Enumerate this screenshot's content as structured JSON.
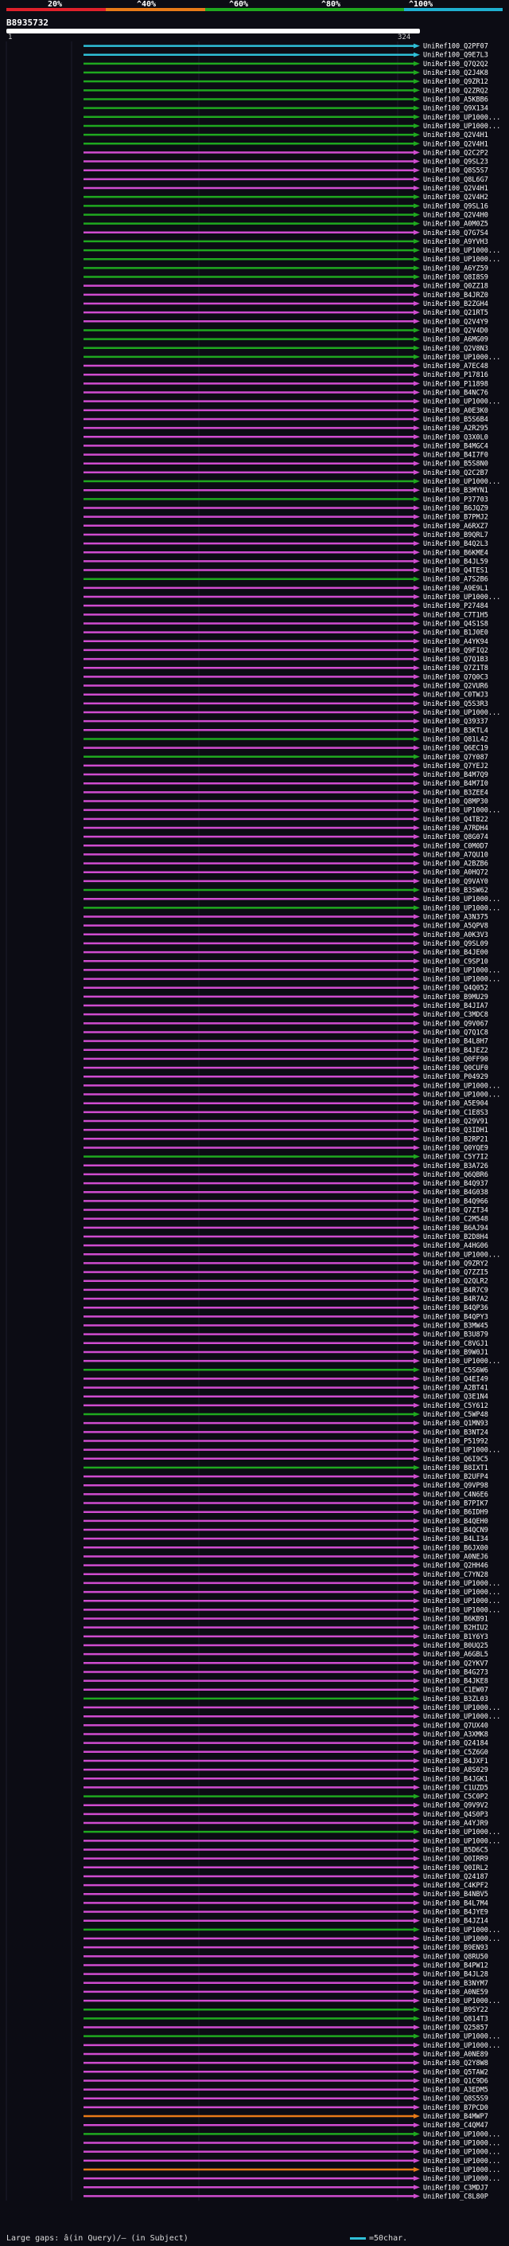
{
  "legend": {
    "labels": [
      "20%",
      "^40%",
      "^60%",
      "^80%",
      "^100%"
    ],
    "colors": [
      "#e0202a",
      "#e87a18",
      "#1fa81f",
      "#1fa81f",
      "#1fb0d0"
    ]
  },
  "query": {
    "id": "B8935732",
    "start": "1",
    "end": "324"
  },
  "footer": {
    "large_gaps": "Large gaps: â(in Query)/– (in Subject)",
    "scale": "=50char."
  },
  "hits": [
    {
      "label": "UniRef100_Q2PF07",
      "color": "#2fc0d8"
    },
    {
      "label": "UniRef100_Q9E7L3",
      "color": "#2fc0d8"
    },
    {
      "label": "UniRef100_Q7Q2Q2",
      "color": "#1fa81f"
    },
    {
      "label": "UniRef100_Q2J4K8",
      "color": "#1fa81f"
    },
    {
      "label": "UniRef100_Q9ZR12",
      "color": "#1fa81f"
    },
    {
      "label": "UniRef100_Q2ZRQ2",
      "color": "#1fa81f"
    },
    {
      "label": "UniRef100_A5KBB6",
      "color": "#1fa81f"
    },
    {
      "label": "UniRef100_Q9X134",
      "color": "#1fa81f"
    },
    {
      "label": "UniRef100_UP1000...",
      "color": "#1fa81f"
    },
    {
      "label": "UniRef100_UP1000...",
      "color": "#1fa81f"
    },
    {
      "label": "UniRef100_Q2V4H1",
      "color": "#1fa81f"
    },
    {
      "label": "UniRef100_Q2V4H1",
      "color": "#1fa81f"
    },
    {
      "label": "UniRef100_Q2C2P2",
      "color": "#d04cd0"
    },
    {
      "label": "UniRef100_Q9SL23",
      "color": "#d04cd0"
    },
    {
      "label": "UniRef100_Q8S5S7",
      "color": "#d04cd0"
    },
    {
      "label": "UniRef100_Q8L6G7",
      "color": "#d04cd0"
    },
    {
      "label": "UniRef100_Q2V4H1",
      "color": "#d04cd0"
    },
    {
      "label": "UniRef100_Q2V4H2",
      "color": "#1fa81f"
    },
    {
      "label": "UniRef100_Q9SL16",
      "color": "#1fa81f"
    },
    {
      "label": "UniRef100_Q2V4H0",
      "color": "#1fa81f"
    },
    {
      "label": "UniRef100_A0M0Z5",
      "color": "#1fa81f"
    },
    {
      "label": "UniRef100_Q7G7S4",
      "color": "#d04cd0"
    },
    {
      "label": "UniRef100_A9YVH3",
      "color": "#1fa81f"
    },
    {
      "label": "UniRef100_UP1000...",
      "color": "#1fa81f"
    },
    {
      "label": "UniRef100_UP1000...",
      "color": "#1fa81f"
    },
    {
      "label": "UniRef100_A6YZ59",
      "color": "#1fa81f"
    },
    {
      "label": "UniRef100_Q8I8S9",
      "color": "#1fa81f"
    },
    {
      "label": "UniRef100_Q0ZZ18",
      "color": "#d04cd0"
    },
    {
      "label": "UniRef100_B4JRZ0",
      "color": "#d04cd0"
    },
    {
      "label": "UniRef100_B2ZGH4",
      "color": "#d04cd0"
    },
    {
      "label": "UniRef100_Q21RT5",
      "color": "#d04cd0"
    },
    {
      "label": "UniRef100_Q2V4Y9",
      "color": "#d04cd0"
    },
    {
      "label": "UniRef100_Q2V4D0",
      "color": "#1fa81f"
    },
    {
      "label": "UniRef100_A6MG09",
      "color": "#1fa81f"
    },
    {
      "label": "UniRef100_Q2V8N3",
      "color": "#1fa81f"
    },
    {
      "label": "UniRef100_UP1000...",
      "color": "#1fa81f"
    },
    {
      "label": "UniRef100_A7EC48",
      "color": "#d04cd0"
    },
    {
      "label": "UniRef100_P17816",
      "color": "#d04cd0"
    },
    {
      "label": "UniRef100_P11898",
      "color": "#d04cd0"
    },
    {
      "label": "UniRef100_B4NC76",
      "color": "#d04cd0"
    },
    {
      "label": "UniRef100_UP1000...",
      "color": "#d04cd0"
    },
    {
      "label": "UniRef100_A0E3K0",
      "color": "#d04cd0"
    },
    {
      "label": "UniRef100_B5S6B4",
      "color": "#d04cd0"
    },
    {
      "label": "UniRef100_A2R295",
      "color": "#d04cd0"
    },
    {
      "label": "UniRef100_Q3X0L0",
      "color": "#d04cd0"
    },
    {
      "label": "UniRef100_B4MGC4",
      "color": "#d04cd0"
    },
    {
      "label": "UniRef100_B4I7F0",
      "color": "#d04cd0"
    },
    {
      "label": "UniRef100_B5S8N0",
      "color": "#d04cd0"
    },
    {
      "label": "UniRef100_Q2C2B7",
      "color": "#d04cd0"
    },
    {
      "label": "UniRef100_UP1000...",
      "color": "#1fa81f"
    },
    {
      "label": "UniRef100_B3MYN1",
      "color": "#d04cd0"
    },
    {
      "label": "UniRef100_P37703",
      "color": "#1fa81f"
    },
    {
      "label": "UniRef100_B6JQZ9",
      "color": "#d04cd0"
    },
    {
      "label": "UniRef100_B7PMJ2",
      "color": "#d04cd0"
    },
    {
      "label": "UniRef100_A6RXZ7",
      "color": "#d04cd0"
    },
    {
      "label": "UniRef100_B9QRL7",
      "color": "#d04cd0"
    },
    {
      "label": "UniRef100_B4Q2L3",
      "color": "#d04cd0"
    },
    {
      "label": "UniRef100_B6KME4",
      "color": "#d04cd0"
    },
    {
      "label": "UniRef100_B4JL59",
      "color": "#d04cd0"
    },
    {
      "label": "UniRef100_Q4TES1",
      "color": "#d04cd0"
    },
    {
      "label": "UniRef100_A7S2B6",
      "color": "#1fa81f"
    },
    {
      "label": "UniRef100_A9E9L1",
      "color": "#d04cd0"
    },
    {
      "label": "UniRef100_UP1000...",
      "color": "#d04cd0"
    },
    {
      "label": "UniRef100_P27484",
      "color": "#d04cd0"
    },
    {
      "label": "UniRef100_C7T1H5",
      "color": "#d04cd0"
    },
    {
      "label": "UniRef100_Q4S1S8",
      "color": "#d04cd0"
    },
    {
      "label": "UniRef100_B1J0E0",
      "color": "#d04cd0"
    },
    {
      "label": "UniRef100_A4YK94",
      "color": "#d04cd0"
    },
    {
      "label": "UniRef100_Q9FIQ2",
      "color": "#d04cd0"
    },
    {
      "label": "UniRef100_Q7Q1B3",
      "color": "#d04cd0"
    },
    {
      "label": "UniRef100_Q7Z1T8",
      "color": "#d04cd0"
    },
    {
      "label": "UniRef100_Q7Q0C3",
      "color": "#d04cd0"
    },
    {
      "label": "UniRef100_Q2VUR6",
      "color": "#d04cd0"
    },
    {
      "label": "UniRef100_C0TWJ3",
      "color": "#d04cd0"
    },
    {
      "label": "UniRef100_Q5S3R3",
      "color": "#d04cd0"
    },
    {
      "label": "UniRef100_UP1000...",
      "color": "#d04cd0"
    },
    {
      "label": "UniRef100_Q39337",
      "color": "#d04cd0"
    },
    {
      "label": "UniRef100_B3KTL4",
      "color": "#d04cd0"
    },
    {
      "label": "UniRef100_Q81L42",
      "color": "#1fa81f"
    },
    {
      "label": "UniRef100_Q6EC19",
      "color": "#d04cd0"
    },
    {
      "label": "UniRef100_Q7Y087",
      "color": "#1fa81f"
    },
    {
      "label": "UniRef100_Q7YEJ2",
      "color": "#d04cd0"
    },
    {
      "label": "UniRef100_B4M7Q9",
      "color": "#d04cd0"
    },
    {
      "label": "UniRef100_B4M7I0",
      "color": "#d04cd0"
    },
    {
      "label": "UniRef100_B3ZEE4",
      "color": "#d04cd0"
    },
    {
      "label": "UniRef100_Q8MP30",
      "color": "#d04cd0"
    },
    {
      "label": "UniRef100_UP1000...",
      "color": "#d04cd0"
    },
    {
      "label": "UniRef100_Q4TB22",
      "color": "#d04cd0"
    },
    {
      "label": "UniRef100_A7RDH4",
      "color": "#d04cd0"
    },
    {
      "label": "UniRef100_Q8G074",
      "color": "#d04cd0"
    },
    {
      "label": "UniRef100_C0M0D7",
      "color": "#d04cd0"
    },
    {
      "label": "UniRef100_A7QU10",
      "color": "#d04cd0"
    },
    {
      "label": "UniRef100_A2BZB6",
      "color": "#d04cd0"
    },
    {
      "label": "UniRef100_A0HQ72",
      "color": "#d04cd0"
    },
    {
      "label": "UniRef100_Q9VAY0",
      "color": "#d04cd0"
    },
    {
      "label": "UniRef100_B3SW62",
      "color": "#1fa81f"
    },
    {
      "label": "UniRef100_UP1000...",
      "color": "#d04cd0"
    },
    {
      "label": "UniRef100_UP1000...",
      "color": "#1fa81f"
    },
    {
      "label": "UniRef100_A3N375",
      "color": "#d04cd0"
    },
    {
      "label": "UniRef100_A5QPV8",
      "color": "#d04cd0"
    },
    {
      "label": "UniRef100_A0K3V3",
      "color": "#d04cd0"
    },
    {
      "label": "UniRef100_Q9SL09",
      "color": "#d04cd0"
    },
    {
      "label": "UniRef100_B4JE00",
      "color": "#d04cd0"
    },
    {
      "label": "UniRef100_C9SP10",
      "color": "#d04cd0"
    },
    {
      "label": "UniRef100_UP1000...",
      "color": "#d04cd0"
    },
    {
      "label": "UniRef100_UP1000...",
      "color": "#d04cd0"
    },
    {
      "label": "UniRef100_Q4Q052",
      "color": "#d04cd0"
    },
    {
      "label": "UniRef100_B9MU29",
      "color": "#d04cd0"
    },
    {
      "label": "UniRef100_B4JIA7",
      "color": "#d04cd0"
    },
    {
      "label": "UniRef100_C3MDC8",
      "color": "#d04cd0"
    },
    {
      "label": "UniRef100_Q9V067",
      "color": "#d04cd0"
    },
    {
      "label": "UniRef100_Q7Q1C8",
      "color": "#d04cd0"
    },
    {
      "label": "UniRef100_B4L8H7",
      "color": "#d04cd0"
    },
    {
      "label": "UniRef100_B4JEZ2",
      "color": "#d04cd0"
    },
    {
      "label": "UniRef100_Q0FF90",
      "color": "#d04cd0"
    },
    {
      "label": "UniRef100_Q0CUF0",
      "color": "#d04cd0"
    },
    {
      "label": "UniRef100_P04929",
      "color": "#d04cd0"
    },
    {
      "label": "UniRef100_UP1000...",
      "color": "#d04cd0"
    },
    {
      "label": "UniRef100_UP1000...",
      "color": "#d04cd0"
    },
    {
      "label": "UniRef100_A5E904",
      "color": "#d04cd0"
    },
    {
      "label": "UniRef100_C1E8S3",
      "color": "#d04cd0"
    },
    {
      "label": "UniRef100_Q29V91",
      "color": "#d04cd0"
    },
    {
      "label": "UniRef100_Q3IDH1",
      "color": "#d04cd0"
    },
    {
      "label": "UniRef100_B2RP21",
      "color": "#d04cd0"
    },
    {
      "label": "UniRef100_Q0YQE9",
      "color": "#d04cd0"
    },
    {
      "label": "UniRef100_C5Y7I2",
      "color": "#1fa81f"
    },
    {
      "label": "UniRef100_B3A726",
      "color": "#d04cd0"
    },
    {
      "label": "UniRef100_Q6QBR6",
      "color": "#d04cd0"
    },
    {
      "label": "UniRef100_B4Q937",
      "color": "#d04cd0"
    },
    {
      "label": "UniRef100_B4G038",
      "color": "#d04cd0"
    },
    {
      "label": "UniRef100_B4Q966",
      "color": "#d04cd0"
    },
    {
      "label": "UniRef100_Q7ZT34",
      "color": "#d04cd0"
    },
    {
      "label": "UniRef100_C2M548",
      "color": "#d04cd0"
    },
    {
      "label": "UniRef100_B6AJ94",
      "color": "#d04cd0"
    },
    {
      "label": "UniRef100_B2D8H4",
      "color": "#d04cd0"
    },
    {
      "label": "UniRef100_A4HG06",
      "color": "#d04cd0"
    },
    {
      "label": "UniRef100_UP1000...",
      "color": "#d04cd0"
    },
    {
      "label": "UniRef100_Q9ZRY2",
      "color": "#d04cd0"
    },
    {
      "label": "UniRef100_Q7ZZI5",
      "color": "#d04cd0"
    },
    {
      "label": "UniRef100_Q2QLR2",
      "color": "#d04cd0"
    },
    {
      "label": "UniRef100_B4R7C9",
      "color": "#d04cd0"
    },
    {
      "label": "UniRef100_B4R7A2",
      "color": "#d04cd0"
    },
    {
      "label": "UniRef100_B4QP36",
      "color": "#d04cd0"
    },
    {
      "label": "UniRef100_B4QPY3",
      "color": "#d04cd0"
    },
    {
      "label": "UniRef100_B3MW45",
      "color": "#d04cd0"
    },
    {
      "label": "UniRef100_B3U879",
      "color": "#d04cd0"
    },
    {
      "label": "UniRef100_C8VGJ1",
      "color": "#d04cd0"
    },
    {
      "label": "UniRef100_B9W0J1",
      "color": "#d04cd0"
    },
    {
      "label": "UniRef100_UP1000...",
      "color": "#d04cd0"
    },
    {
      "label": "UniRef100_C5S6W6",
      "color": "#1fa81f"
    },
    {
      "label": "UniRef100_Q4EI49",
      "color": "#d04cd0"
    },
    {
      "label": "UniRef100_A2BT41",
      "color": "#d04cd0"
    },
    {
      "label": "UniRef100_Q3E1N4",
      "color": "#d04cd0"
    },
    {
      "label": "UniRef100_C5Y612",
      "color": "#d04cd0"
    },
    {
      "label": "UniRef100_C5WP48",
      "color": "#1fa81f"
    },
    {
      "label": "UniRef100_Q1MN93",
      "color": "#d04cd0"
    },
    {
      "label": "UniRef100_B3NT24",
      "color": "#d04cd0"
    },
    {
      "label": "UniRef100_P51992",
      "color": "#d04cd0"
    },
    {
      "label": "UniRef100_UP1000...",
      "color": "#d04cd0"
    },
    {
      "label": "UniRef100_Q6I9C5",
      "color": "#d04cd0"
    },
    {
      "label": "UniRef100_B8IXT1",
      "color": "#1fa81f"
    },
    {
      "label": "UniRef100_B2UFP4",
      "color": "#d04cd0"
    },
    {
      "label": "UniRef100_Q9VP98",
      "color": "#d04cd0"
    },
    {
      "label": "UniRef100_C4N6E6",
      "color": "#d04cd0"
    },
    {
      "label": "UniRef100_B7PIK7",
      "color": "#d04cd0"
    },
    {
      "label": "UniRef100_B6IDH9",
      "color": "#d04cd0"
    },
    {
      "label": "UniRef100_B4QEH0",
      "color": "#d04cd0"
    },
    {
      "label": "UniRef100_B4QCN9",
      "color": "#d04cd0"
    },
    {
      "label": "UniRef100_B4LI34",
      "color": "#d04cd0"
    },
    {
      "label": "UniRef100_B6JX00",
      "color": "#d04cd0"
    },
    {
      "label": "UniRef100_A0NEJ6",
      "color": "#d04cd0"
    },
    {
      "label": "UniRef100_Q2HH46",
      "color": "#d04cd0"
    },
    {
      "label": "UniRef100_C7YN28",
      "color": "#d04cd0"
    },
    {
      "label": "UniRef100_UP1000...",
      "color": "#d04cd0"
    },
    {
      "label": "UniRef100_UP1000...",
      "color": "#d04cd0"
    },
    {
      "label": "UniRef100_UP1000...",
      "color": "#d04cd0"
    },
    {
      "label": "UniRef100_UP1000...",
      "color": "#d04cd0"
    },
    {
      "label": "UniRef100_B6KB91",
      "color": "#d04cd0"
    },
    {
      "label": "UniRef100_B2HIU2",
      "color": "#d04cd0"
    },
    {
      "label": "UniRef100_B1Y6Y3",
      "color": "#d04cd0"
    },
    {
      "label": "UniRef100_B0UQ25",
      "color": "#d04cd0"
    },
    {
      "label": "UniRef100_A6GBL5",
      "color": "#d04cd0"
    },
    {
      "label": "UniRef100_Q2YKV7",
      "color": "#d04cd0"
    },
    {
      "label": "UniRef100_B4G273",
      "color": "#d04cd0"
    },
    {
      "label": "UniRef100_B4JKE8",
      "color": "#d04cd0"
    },
    {
      "label": "UniRef100_C1EW07",
      "color": "#d04cd0"
    },
    {
      "label": "UniRef100_B3ZL03",
      "color": "#1fa81f"
    },
    {
      "label": "UniRef100_UP1000...",
      "color": "#d04cd0"
    },
    {
      "label": "UniRef100_UP1000...",
      "color": "#d04cd0"
    },
    {
      "label": "UniRef100_Q7UX40",
      "color": "#d04cd0"
    },
    {
      "label": "UniRef100_A3XMK8",
      "color": "#d04cd0"
    },
    {
      "label": "UniRef100_Q24184",
      "color": "#d04cd0"
    },
    {
      "label": "UniRef100_C5Z6G0",
      "color": "#d04cd0"
    },
    {
      "label": "UniRef100_B4JXF1",
      "color": "#d04cd0"
    },
    {
      "label": "UniRef100_A8S029",
      "color": "#d04cd0"
    },
    {
      "label": "UniRef100_B4JGK1",
      "color": "#d04cd0"
    },
    {
      "label": "UniRef100_C1UZD5",
      "color": "#d04cd0"
    },
    {
      "label": "UniRef100_C5C0P2",
      "color": "#1fa81f"
    },
    {
      "label": "UniRef100_Q9V9V2",
      "color": "#d04cd0"
    },
    {
      "label": "UniRef100_Q4S0P3",
      "color": "#d04cd0"
    },
    {
      "label": "UniRef100_A4YJR9",
      "color": "#d04cd0"
    },
    {
      "label": "UniRef100_UP1000...",
      "color": "#1fa81f"
    },
    {
      "label": "UniRef100_UP1000...",
      "color": "#d04cd0"
    },
    {
      "label": "UniRef100_B5D6C5",
      "color": "#d04cd0"
    },
    {
      "label": "UniRef100_Q0IRR9",
      "color": "#d04cd0"
    },
    {
      "label": "UniRef100_Q0IRL2",
      "color": "#d04cd0"
    },
    {
      "label": "UniRef100_Q24187",
      "color": "#d04cd0"
    },
    {
      "label": "UniRef100_C4KPF2",
      "color": "#d04cd0"
    },
    {
      "label": "UniRef100_B4NBV5",
      "color": "#d04cd0"
    },
    {
      "label": "UniRef100_B4L7M4",
      "color": "#d04cd0"
    },
    {
      "label": "UniRef100_B4JYE9",
      "color": "#d04cd0"
    },
    {
      "label": "UniRef100_B4JZ14",
      "color": "#d04cd0"
    },
    {
      "label": "UniRef100_UP1000...",
      "color": "#1fa81f"
    },
    {
      "label": "UniRef100_UP1000...",
      "color": "#d04cd0"
    },
    {
      "label": "UniRef100_B9EN93",
      "color": "#d04cd0"
    },
    {
      "label": "UniRef100_Q8RU50",
      "color": "#d04cd0"
    },
    {
      "label": "UniRef100_B4PW12",
      "color": "#d04cd0"
    },
    {
      "label": "UniRef100_B4JL28",
      "color": "#d04cd0"
    },
    {
      "label": "UniRef100_B3NYM7",
      "color": "#d04cd0"
    },
    {
      "label": "UniRef100_A0NE59",
      "color": "#d04cd0"
    },
    {
      "label": "UniRef100_UP1000...",
      "color": "#d04cd0"
    },
    {
      "label": "UniRef100_B9SY22",
      "color": "#1fa81f"
    },
    {
      "label": "UniRef100_Q814T3",
      "color": "#1fa81f"
    },
    {
      "label": "UniRef100_Q25857",
      "color": "#d04cd0"
    },
    {
      "label": "UniRef100_UP1000...",
      "color": "#1fa81f"
    },
    {
      "label": "UniRef100_UP1000...",
      "color": "#d04cd0"
    },
    {
      "label": "UniRef100_A0NE89",
      "color": "#d04cd0"
    },
    {
      "label": "UniRef100_Q2Y8W8",
      "color": "#d04cd0"
    },
    {
      "label": "UniRef100_Q5TAW2",
      "color": "#d04cd0"
    },
    {
      "label": "UniRef100_Q1C9D6",
      "color": "#d04cd0"
    },
    {
      "label": "UniRef100_A3EDM5",
      "color": "#d04cd0"
    },
    {
      "label": "UniRef100_Q8S5S9",
      "color": "#d04cd0"
    },
    {
      "label": "UniRef100_B7PCD0",
      "color": "#d04cd0"
    },
    {
      "label": "UniRef100_B4MWP7",
      "color": "#e87a18"
    },
    {
      "label": "UniRef100_C4QM47",
      "color": "#d04cd0"
    },
    {
      "label": "UniRef100_UP1000...",
      "color": "#1fa81f"
    },
    {
      "label": "UniRef100_UP1000...",
      "color": "#d04cd0"
    },
    {
      "label": "UniRef100_UP1000...",
      "color": "#d04cd0"
    },
    {
      "label": "UniRef100_UP1000...",
      "color": "#d04cd0"
    },
    {
      "label": "UniRef100_UP1000...",
      "color": "#e87a18"
    },
    {
      "label": "UniRef100_UP1000...",
      "color": "#d04cd0"
    },
    {
      "label": "UniRef100_C3MDJ7",
      "color": "#d04cd0"
    },
    {
      "label": "UniRef100_C8L80P",
      "color": "#d04cd0"
    }
  ]
}
